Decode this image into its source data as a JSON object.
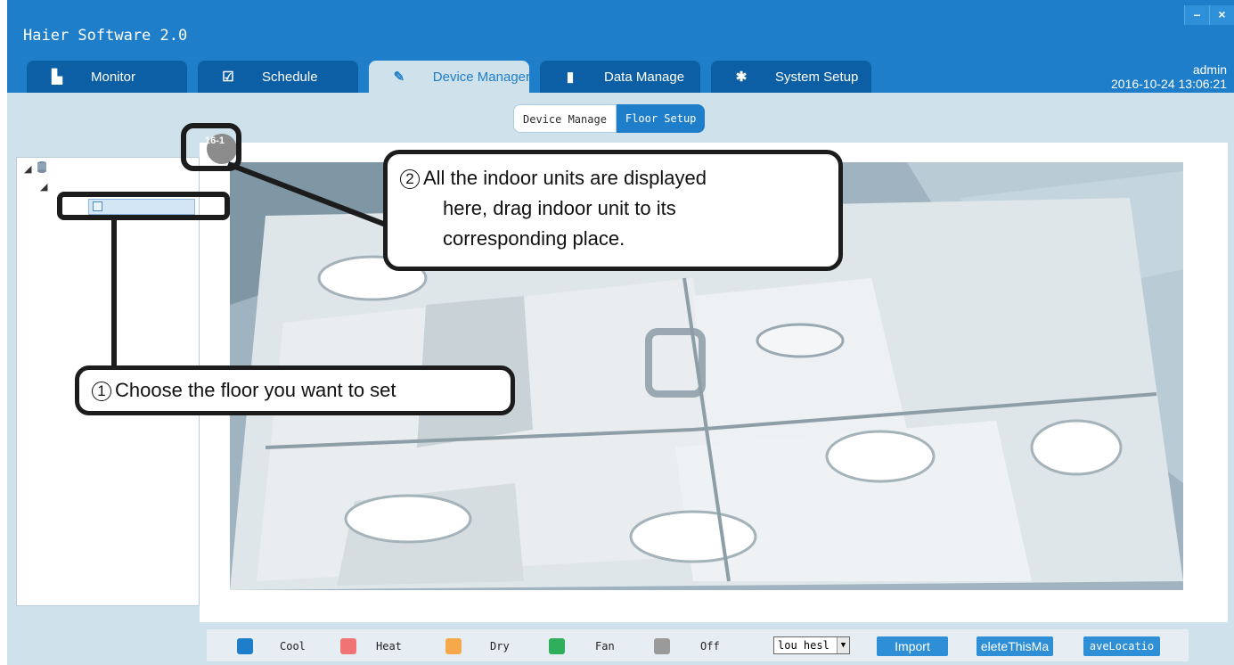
{
  "app": {
    "title": "Haier Software 2.0"
  },
  "window_controls": {
    "minimize": "–",
    "close": "×"
  },
  "tabs": [
    {
      "label": "Monitor",
      "icon": "monitor-icon",
      "glyph": "▙"
    },
    {
      "label": "Schedule",
      "icon": "calendar-icon",
      "glyph": "☑"
    },
    {
      "label": "Device Manager",
      "icon": "wrench-icon",
      "glyph": "✎"
    },
    {
      "label": "Data Manage",
      "icon": "bar-chart-icon",
      "glyph": "▮"
    },
    {
      "label": "System Setup",
      "icon": "gear-icon",
      "glyph": "✱"
    }
  ],
  "user": {
    "name": "admin",
    "datetime": "2016-10-24 13:06:21"
  },
  "subtabs": {
    "device_manage": "Device Manage",
    "floor_setup": "Floor Setup"
  },
  "unit": {
    "label": "16-1"
  },
  "callouts": {
    "one": {
      "number": "1",
      "text": "Choose the floor you want to set"
    },
    "two": {
      "number": "2",
      "line1": "All the indoor units are displayed",
      "line2": "here, drag indoor unit to its",
      "line3": "corresponding place."
    }
  },
  "legend": {
    "cool": {
      "label": "Cool",
      "color": "#1f7ec9"
    },
    "heat": {
      "label": "Heat",
      "color": "#f07474"
    },
    "dry": {
      "label": "Dry",
      "color": "#f5a94a"
    },
    "fan": {
      "label": "Fan",
      "color": "#2fae5c"
    },
    "off": {
      "label": "Off",
      "color": "#9a9a9a"
    }
  },
  "map_select": {
    "value": "lou hesl"
  },
  "buttons": {
    "import": "Import",
    "delete": "eleteThisMa",
    "save": "aveLocatio"
  }
}
